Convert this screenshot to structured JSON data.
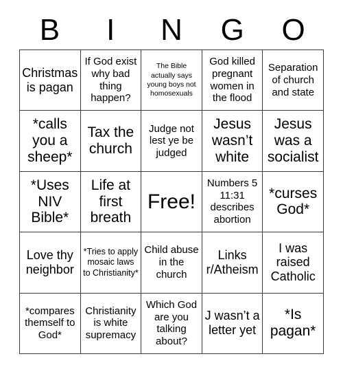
{
  "card": {
    "header_letters": [
      "B",
      "I",
      "N",
      "G",
      "O"
    ],
    "grid": {
      "rows": 5,
      "columns": 5,
      "border_color": "#3a3a3a",
      "background_color": "#ffffff",
      "text_color": "#000000"
    },
    "cells": [
      {
        "text": "Christmas is pagan",
        "size": "large",
        "free": false
      },
      {
        "text": "If God exist why bad thing happen?",
        "size": "medium",
        "free": false
      },
      {
        "text": "The Bible actually says young boys not homosexuals",
        "size": "xsmall",
        "free": false
      },
      {
        "text": "God killed pregnant women in the flood",
        "size": "medium",
        "free": false
      },
      {
        "text": "Separation of church and state",
        "size": "medium",
        "free": false
      },
      {
        "text": "*calls you a sheep*",
        "size": "xlarge",
        "free": false
      },
      {
        "text": "Tax the church",
        "size": "xlarge",
        "free": false
      },
      {
        "text": "Judge not lest ye be judged",
        "size": "medium",
        "free": false
      },
      {
        "text": "Jesus wasn’t white",
        "size": "xlarge",
        "free": false
      },
      {
        "text": "Jesus was a socialist",
        "size": "xlarge",
        "free": false
      },
      {
        "text": "*Uses NIV Bible*",
        "size": "xlarge",
        "free": false
      },
      {
        "text": "Life at first breath",
        "size": "xlarge",
        "free": false
      },
      {
        "text": "Free!",
        "size": "free",
        "free": true
      },
      {
        "text": "Numbers 5 11:31 describes abortion",
        "size": "medium",
        "free": false
      },
      {
        "text": "*curses God*",
        "size": "xlarge",
        "free": false
      },
      {
        "text": "Love thy neighbor",
        "size": "large",
        "free": false
      },
      {
        "text": "*Tries to apply mosaic laws to Christianity*",
        "size": "small",
        "free": false
      },
      {
        "text": "Child abuse in the church",
        "size": "medium",
        "free": false
      },
      {
        "text": "Links r/Atheism",
        "size": "large",
        "free": false
      },
      {
        "text": "I was raised Catholic",
        "size": "large",
        "free": false
      },
      {
        "text": "*compares themself to God*",
        "size": "medium",
        "free": false
      },
      {
        "text": "Christianity is white supremacy",
        "size": "medium",
        "free": false
      },
      {
        "text": "Which God are you talking about?",
        "size": "medium",
        "free": false
      },
      {
        "text": "J wasn’t a letter yet",
        "size": "large",
        "free": false
      },
      {
        "text": "*Is pagan*",
        "size": "xlarge",
        "free": false
      }
    ]
  }
}
